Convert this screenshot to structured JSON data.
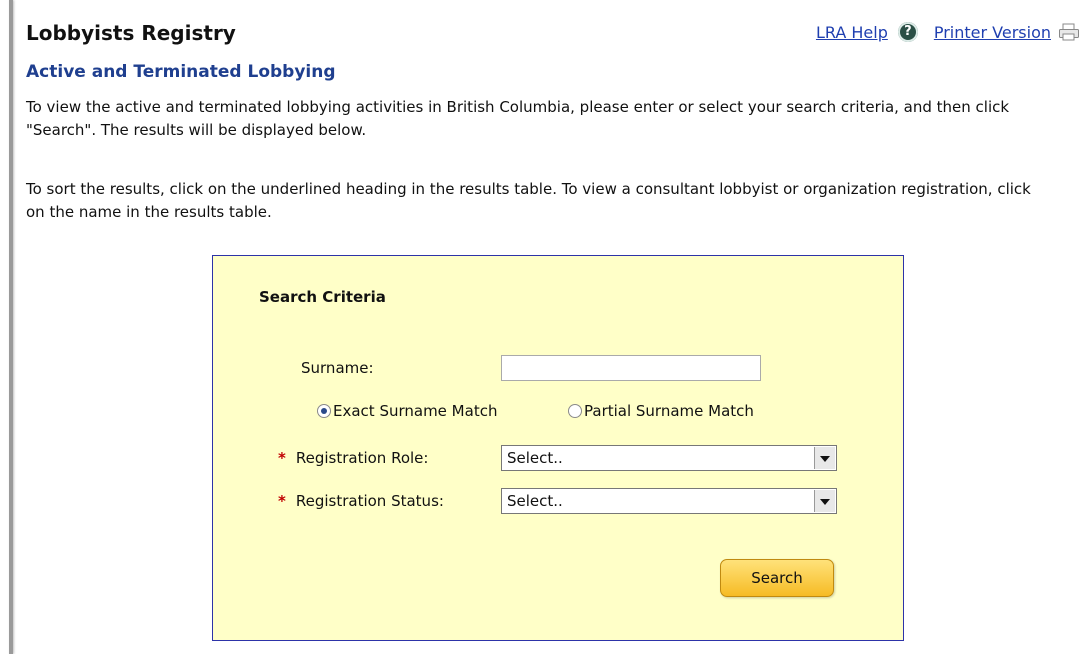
{
  "header": {
    "title": "Lobbyists Registry",
    "help_link": "LRA Help",
    "printer_link": "Printer Version"
  },
  "section_title": "Active and Terminated Lobbying",
  "paragraphs": [
    "To view the active and terminated lobbying activities in British Columbia, please enter or select your search criteria, and then click \"Search\". The results will be displayed below.",
    "To sort the results, click on the underlined heading in the results table. To view a consultant lobbyist or organization registration, click on the name in the results table."
  ],
  "search_form": {
    "title": "Search Criteria",
    "surname_label": "Surname:",
    "surname_value": "",
    "match_options": [
      {
        "label": "Exact Surname Match",
        "selected": true
      },
      {
        "label": "Partial Surname Match",
        "selected": false
      }
    ],
    "required_mark": "*",
    "role_label": "Registration Role:",
    "role_value": "Select..",
    "status_label": "Registration Status:",
    "status_value": "Select..",
    "search_button": "Search"
  },
  "colors": {
    "panel_background": "#ffffc8",
    "panel_border": "#2d33a8",
    "link": "#1f3fb0",
    "section_title": "#1f3f8f",
    "required": "#c00000",
    "button": "#f6bb24"
  },
  "icons": {
    "help": "help-circle-icon",
    "printer": "printer-icon"
  }
}
